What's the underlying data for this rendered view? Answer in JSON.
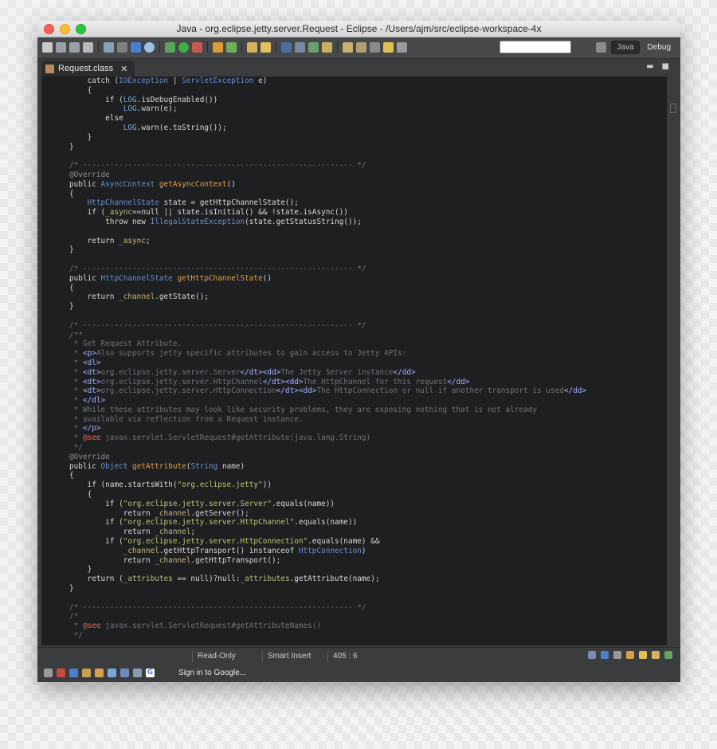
{
  "window": {
    "title": "Java - org.eclipse.jetty.server.Request - Eclipse - /Users/ajm/src/eclipse-workspace-4x"
  },
  "toolbar": {
    "perspective_java": "Java",
    "perspective_debug": "Debug"
  },
  "editor": {
    "tab_label": "Request.class",
    "tab_close": "✕"
  },
  "code_lines": [
    "    catch (IOException | ServletException e)",
    "    {",
    "        if (LOG.isDebugEnabled())",
    "            LOG.warn(e);",
    "        else",
    "            LOG.warn(e.toString());",
    "    }",
    "}",
    "",
    "/* ------------------------------------------------------------ */",
    "@Override",
    "public AsyncContext getAsyncContext()",
    "{",
    "    HttpChannelState state = getHttpChannelState();",
    "    if (_async==null || state.isInitial() && !state.isAsync())",
    "        throw new IllegalStateException(state.getStatusString());",
    "",
    "    return _async;",
    "}",
    "",
    "/* ------------------------------------------------------------ */",
    "public HttpChannelState getHttpChannelState()",
    "{",
    "    return _channel.getState();",
    "}",
    "",
    "/* ------------------------------------------------------------ */",
    "/**",
    " * Get Request Attribute.",
    " * <p>Also supports jetty specific attributes to gain access to Jetty APIs:",
    " * <dl>",
    " * <dt>org.eclipse.jetty.server.Server</dt><dd>The Jetty Server instance</dd>",
    " * <dt>org.eclipse.jetty.server.HttpChannel</dt><dd>The HttpChannel for this request</dd>",
    " * <dt>org.eclipse.jetty.server.HttpConnection</dt><dd>The HttpConnection or null if another transport is used</dd>",
    " * </dl>",
    " * While these attributes may look like security problems, they are exposing nothing that is not already",
    " * available via reflection from a Request instance.",
    " * </p>",
    " * @see javax.servlet.ServletRequest#getAttribute(java.lang.String)",
    " */",
    "@Override",
    "public Object getAttribute(String name)",
    "{",
    "    if (name.startsWith(\"org.eclipse.jetty\"))",
    "    {",
    "        if (\"org.eclipse.jetty.server.Server\".equals(name))",
    "            return _channel.getServer();",
    "        if (\"org.eclipse.jetty.server.HttpChannel\".equals(name))",
    "            return _channel;",
    "        if (\"org.eclipse.jetty.server.HttpConnection\".equals(name) &&",
    "            _channel.getHttpTransport() instanceof HttpConnection)",
    "            return _channel.getHttpTransport();",
    "    }",
    "    return (_attributes == null)?null:_attributes.getAttribute(name);",
    "}",
    "",
    "/* ------------------------------------------------------------ */",
    "/*",
    " * @see javax.servlet.ServletRequest#getAttributeNames()",
    " */"
  ],
  "status": {
    "mode": "Read-Only",
    "insert": "Smart Insert",
    "position": "405 : 6"
  },
  "bottom": {
    "signin": "Sign in to Google..."
  },
  "colors": {
    "editor_bg": "#1e1f21",
    "keyword": "#d8d8d8",
    "type": "#6d8fcc",
    "method": "#e2a04d",
    "string": "#b7c96e",
    "comment": "#6e7378"
  }
}
